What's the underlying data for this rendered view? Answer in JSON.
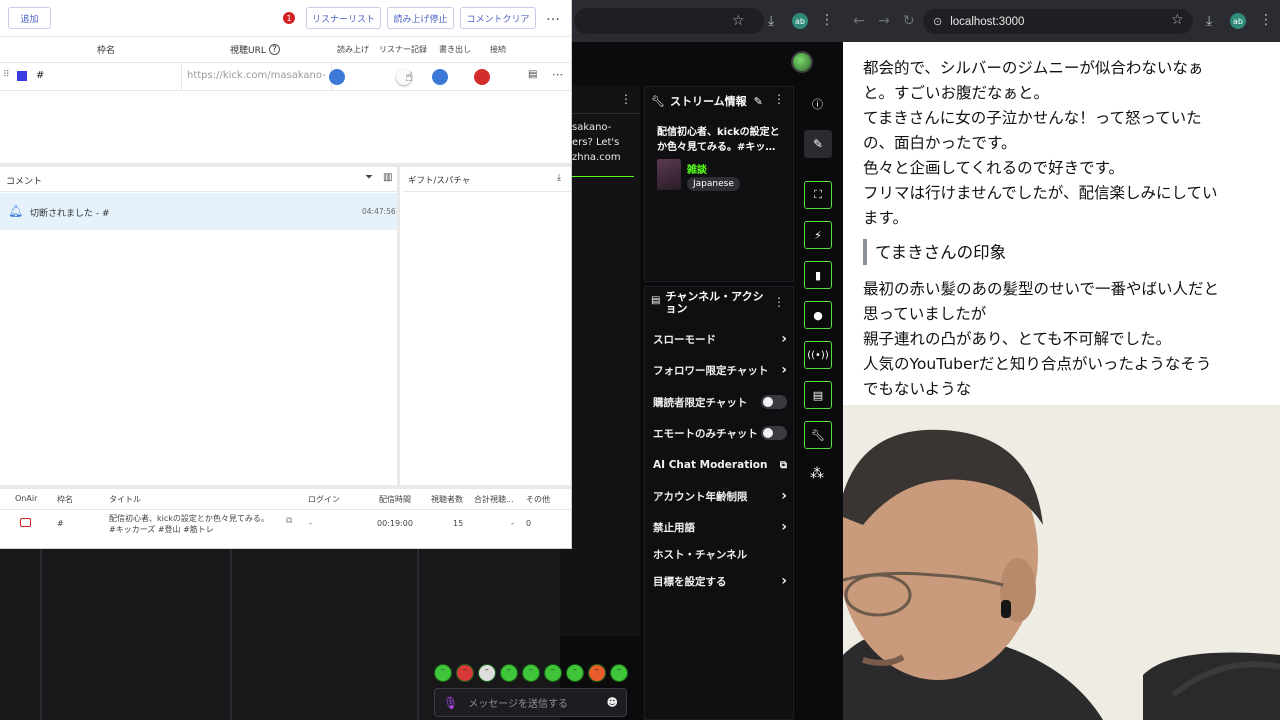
{
  "comment_app": {
    "toolbar": {
      "add_label": "追加",
      "badge_count": "1",
      "listener_list": "リスナーリスト",
      "stop_reading": "読み上げ停止",
      "clear_comments": "コメントクリア",
      "more": "…"
    },
    "table_headers": {
      "name": "枠名",
      "url": "視聴URL",
      "read": "読み上げ",
      "listener_record": "リスナー記録",
      "export": "書き出し",
      "connect": "接続"
    },
    "row": {
      "name": "#",
      "url": "https://kick.com/masakano-",
      "color": "#3b3be0"
    },
    "comments": {
      "title": "コメント",
      "items": [
        {
          "text": "切断されました - #",
          "time": "04:47:56"
        }
      ]
    },
    "gifts": {
      "title": "ギフト/スパチャ"
    },
    "stream_table": {
      "headers": [
        "OnAir",
        "枠名",
        "タイトル",
        "ログイン",
        "配信時間",
        "視聴者数",
        "合計視聴...",
        "その他"
      ],
      "rows": [
        {
          "name": "#",
          "title_line1": "配信初心者、kickの設定とか色々見てみる。",
          "title_line2": "#キッカーズ #登山 #筋トレ",
          "login": "-",
          "duration": "00:19:00",
          "viewers": "15",
          "total": "-",
          "other": "0"
        }
      ]
    }
  },
  "kick": {
    "chat_fragment": [
      "sakano-",
      "ers? Let's",
      "zhna.com"
    ],
    "stream_info": {
      "title": "ストリーム情報",
      "stream_title": "配信初心者、kickの設定とか色々見てみる。#キッ…",
      "category": "雑談",
      "language": "Japanese"
    },
    "channel_actions": {
      "title": "チャンネル・アクション",
      "items": [
        {
          "label": "スローモード",
          "type": "chevron"
        },
        {
          "label": "フォロワー限定チャット",
          "type": "chevron"
        },
        {
          "label": "購読者限定チャット",
          "type": "toggle"
        },
        {
          "label": "エモートのみチャット",
          "type": "toggle"
        },
        {
          "label": "AI Chat Moderation",
          "type": "external"
        },
        {
          "label": "アカウント年齢制限",
          "type": "chevron"
        },
        {
          "label": "禁止用語",
          "type": "chevron"
        },
        {
          "label": "ホスト・チャンネル",
          "type": "none"
        },
        {
          "label": "目標を設定する",
          "type": "chevron"
        }
      ]
    },
    "message_placeholder": "メッセージを送信する",
    "accent": "#53fc18"
  },
  "local_browser": {
    "url": "localhost:3000",
    "profile": "ab",
    "article": {
      "para1": [
        "都会的で、シルバーのジムニーが似合わないなぁ",
        "と。すごいお腹だなぁと。",
        "てまきさんに女の子泣かせんな！って怒っていた",
        "の、面白かったです。",
        "色々と企画してくれるので好きです。",
        "フリマは行けませんでしたが、配信楽しみにしてい",
        "ます。"
      ],
      "heading": "てまきさんの印象",
      "para2": [
        "最初の赤い髪のあの髪型のせいで一番やばい人だと",
        "思っていましたが",
        "親子連れの凸があり、とても不可解でした。",
        "人気のYouTuberだと知り合点がいったようなそう",
        "でもないような"
      ]
    }
  }
}
